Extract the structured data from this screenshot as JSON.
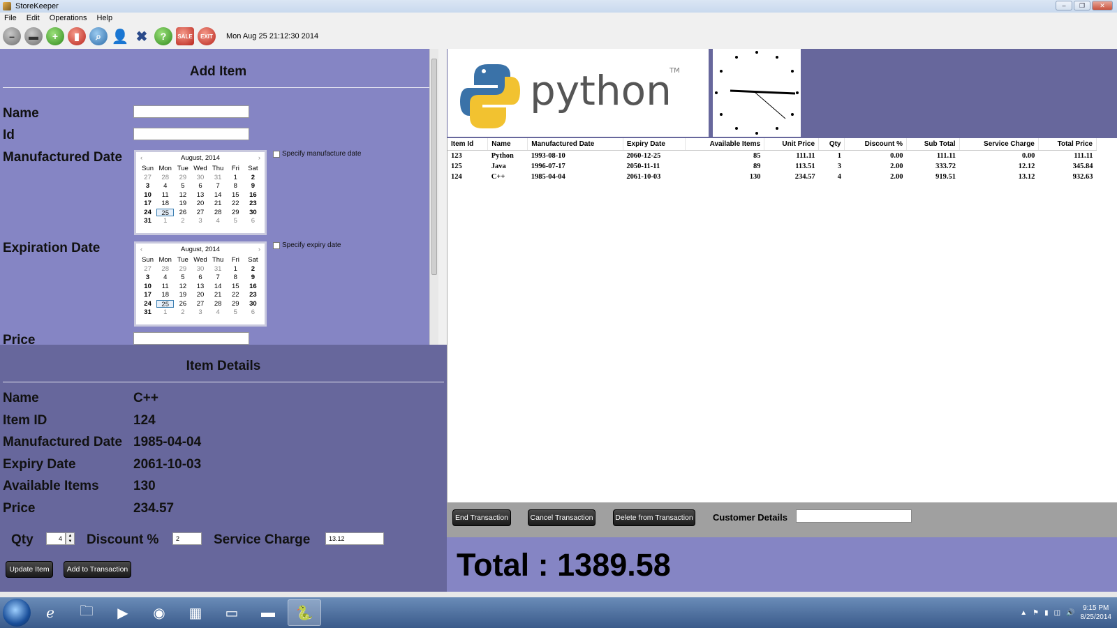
{
  "window": {
    "title": "StoreKeeper"
  },
  "menu": [
    "File",
    "Edit",
    "Operations",
    "Help"
  ],
  "toolbar": {
    "datetime": "Mon Aug 25 21:12:30 2014",
    "icons": [
      "minus-icon",
      "dash-icon",
      "add-icon",
      "delete-icon",
      "search-icon",
      "add-user-icon",
      "remove-user-icon",
      "help-icon",
      "sale-icon",
      "exit-icon"
    ]
  },
  "add_item": {
    "heading": "Add Item",
    "labels": {
      "name": "Name",
      "id": "Id",
      "manufactured": "Manufactured Date",
      "expiration": "Expiration Date",
      "price": "Price"
    },
    "specify_manufacture": "Specify manufacture date",
    "specify_expiry": "Specify expiry date",
    "calendar": {
      "month": "August, 2014",
      "days": [
        "Sun",
        "Mon",
        "Tue",
        "Wed",
        "Thu",
        "Fri",
        "Sat"
      ],
      "dates": [
        [
          "27",
          "28",
          "29",
          "30",
          "31",
          "1",
          "2"
        ],
        [
          "3",
          "4",
          "5",
          "6",
          "7",
          "8",
          "9"
        ],
        [
          "10",
          "11",
          "12",
          "13",
          "14",
          "15",
          "16"
        ],
        [
          "17",
          "18",
          "19",
          "20",
          "21",
          "22",
          "23"
        ],
        [
          "24",
          "25",
          "26",
          "27",
          "28",
          "29",
          "30"
        ],
        [
          "31",
          "1",
          "2",
          "3",
          "4",
          "5",
          "6"
        ]
      ],
      "selected": "25"
    }
  },
  "item_details": {
    "heading": "Item Details",
    "rows": [
      {
        "label": "Name",
        "value": "C++"
      },
      {
        "label": "Item ID",
        "value": "124"
      },
      {
        "label": "Manufactured Date",
        "value": "1985-04-04"
      },
      {
        "label": "Expiry Date",
        "value": "2061-10-03"
      },
      {
        "label": "Available Items",
        "value": "130"
      },
      {
        "label": "Price",
        "value": "234.57"
      }
    ],
    "qty_label": "Qty",
    "qty_value": "4",
    "discount_label": "Discount %",
    "discount_value": "2",
    "service_label": "Service Charge",
    "service_value": "13.12",
    "update_btn": "Update Item",
    "add_btn": "Add to Transaction"
  },
  "logo": {
    "text": "python",
    "tm": "TM"
  },
  "table": {
    "columns": [
      "Item Id",
      "Name",
      "Manufactured Date",
      "Expiry Date",
      "Available Items",
      "Unit Price",
      "Qty",
      "Discount %",
      "Sub Total",
      "Service Charge",
      "Total Price"
    ],
    "rows": [
      [
        "123",
        "Python",
        "1993-08-10",
        "2060-12-25",
        "85",
        "111.11",
        "1",
        "0.00",
        "111.11",
        "0.00",
        "111.11"
      ],
      [
        "125",
        "Java",
        "1996-07-17",
        "2050-11-11",
        "89",
        "113.51",
        "3",
        "2.00",
        "333.72",
        "12.12",
        "345.84"
      ],
      [
        "124",
        "C++",
        "1985-04-04",
        "2061-10-03",
        "130",
        "234.57",
        "4",
        "2.00",
        "919.51",
        "13.12",
        "932.63"
      ]
    ]
  },
  "transaction": {
    "end_btn": "End Transaction",
    "cancel_btn": "Cancel Transaction",
    "delete_btn": "Delete from Transaction",
    "customer_label": "Customer Details"
  },
  "total": {
    "text": "Total :  1389.58"
  },
  "taskbar": {
    "time": "9:15 PM",
    "date": "8/25/2014"
  },
  "colors": {
    "add_panel": "#8585c4",
    "details_panel": "#67679c"
  }
}
